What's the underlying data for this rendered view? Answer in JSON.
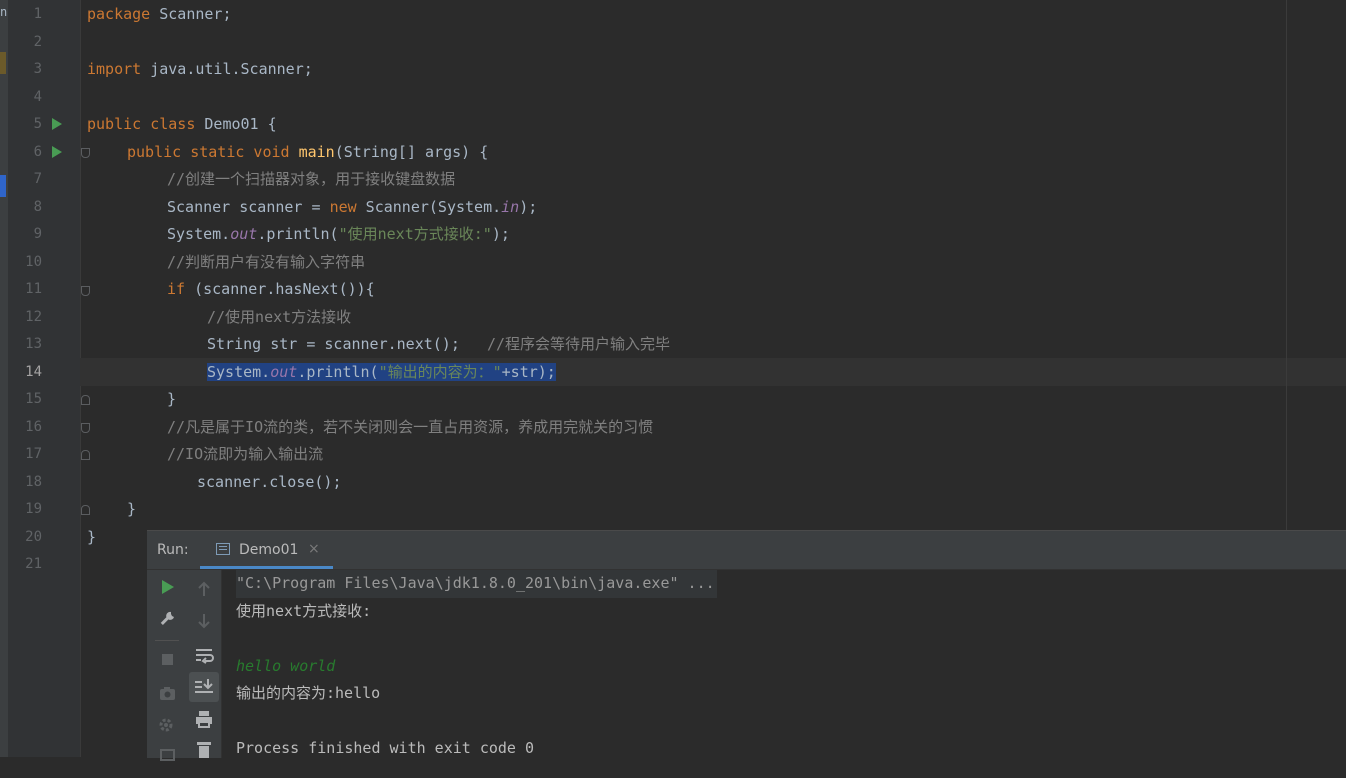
{
  "gutter": {
    "line_numbers": [
      "1",
      "2",
      "3",
      "4",
      "5",
      "6",
      "7",
      "8",
      "9",
      "10",
      "11",
      "12",
      "13",
      "14",
      "15",
      "16",
      "17",
      "18",
      "19",
      "20",
      "21"
    ],
    "current_line": "14"
  },
  "code": {
    "l1": {
      "kw": "package",
      "rest": " Scanner;"
    },
    "l3": {
      "kw": "import",
      "rest": " java.util.Scanner;"
    },
    "l5": {
      "kw": "public class",
      "rest": " Demo01 {"
    },
    "l6": {
      "kw": "public static void",
      "fn": "main",
      "rest": "(String[] args) {"
    },
    "l7": {
      "comment": "//创建一个扫描器对象，用于接收键盘数据"
    },
    "l8": {
      "pre": "Scanner scanner = ",
      "kw": "new",
      "mid": " Scanner(System.",
      "it": "in",
      "post": ");"
    },
    "l9": {
      "pre": "System.",
      "it": "out",
      "mid": ".println(",
      "str": "\"使用next方式接收:\"",
      "post": ");"
    },
    "l10": {
      "comment": "//判断用户有没有输入字符串"
    },
    "l11": {
      "kw": "if",
      "rest": " (scanner.hasNext()){"
    },
    "l12": {
      "comment": "//使用next方法接收"
    },
    "l13": {
      "pre": "String str = scanner.next();",
      "comment": "   //程序会等待用户输入完毕"
    },
    "l14": {
      "pre": "System.",
      "it": "out",
      "mid": ".println(",
      "str": "\"输出的内容为：\"",
      "post": "+str);"
    },
    "l15": {
      "rest": "}"
    },
    "l16": {
      "comment": "//凡是属于IO流的类，若不关闭则会一直占用资源，养成用完就关的习惯"
    },
    "l17": {
      "comment": "//IO流即为输入输出流"
    },
    "l18": {
      "pre": "scanner.close();"
    },
    "l19": {
      "rest": "}"
    },
    "l20": {
      "rest": "}"
    }
  },
  "run_panel": {
    "label": "Run:",
    "tab_name": "Demo01",
    "tab_close": "×",
    "console_lines": {
      "cmd": "\"C:\\Program Files\\Java\\jdk1.8.0_201\\bin\\java.exe\" ...",
      "prompt": "使用next方式接收:",
      "input": "hello world",
      "output": "输出的内容为:hello",
      "exit": "Process finished with exit code 0"
    },
    "tools": {
      "col1": [
        "run-icon",
        "wrench-icon",
        "stop-icon",
        "camera-icon",
        "gear-icon"
      ],
      "col2": [
        "up-arrow-icon",
        "down-arrow-icon",
        "soft-wrap-icon",
        "scroll-to-end-icon",
        "print-icon",
        "trash-icon"
      ]
    }
  },
  "colors": {
    "keyword": "#cc7832",
    "method": "#ffc66d",
    "string": "#6a8759",
    "comment": "#808080",
    "field_italic": "#9876aa",
    "selection": "#214283",
    "run_green": "#499c54",
    "user_input": "#287b2e"
  }
}
